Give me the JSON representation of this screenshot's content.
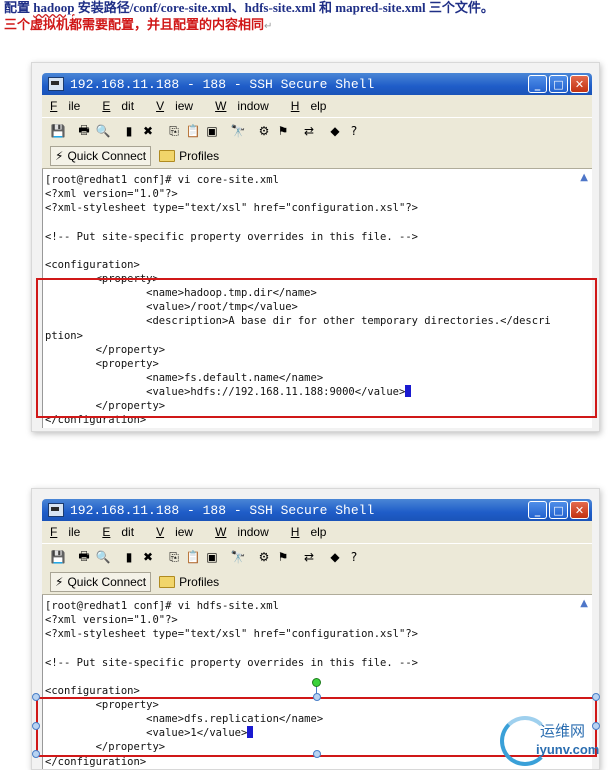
{
  "intro": {
    "line1_prefix": "配置 ",
    "line1_word": "hadoop",
    "line1_rest": " 安装路径/conf/core-site.xml、hdfs-site.xml 和 mapred-site.xml 三个文件。",
    "line2": "三个虚拟机都需要配置，并且配置的内容相同",
    "line2_mark": "↵"
  },
  "window": {
    "title": "192.168.11.188 - 188 - SSH Secure Shell",
    "menu": [
      {
        "first": "F",
        "rest": "ile"
      },
      {
        "first": "E",
        "rest": "dit"
      },
      {
        "first": "V",
        "rest": "iew"
      },
      {
        "first": "W",
        "rest": "indow"
      },
      {
        "first": "H",
        "rest": "elp"
      }
    ],
    "quick_connect": "Quick Connect",
    "profiles": "Profiles"
  },
  "colors": {
    "accent_red": "#d01818",
    "title_blue": "#1f5dc8",
    "cursor_blue": "#1a1ad0"
  },
  "terminal1": {
    "lines": [
      "[root@redhat1 conf]# vi core-site.xml",
      "<?xml version=\"1.0\"?>",
      "<?xml-stylesheet type=\"text/xsl\" href=\"configuration.xsl\"?>",
      "",
      "<!-- Put site-specific property overrides in this file. -->",
      "",
      "<configuration>",
      "        <property>",
      "                <name>hadoop.tmp.dir</name>",
      "                <value>/root/tmp</value>",
      "                <description>A base dir for other temporary directories.</descri",
      "ption>",
      "        </property>",
      "        <property>",
      "                <name>fs.default.name</name>",
      "                <value>hdfs://192.168.11.188:9000</value>",
      "        </property>",
      "</configuration>"
    ]
  },
  "terminal2": {
    "lines": [
      "[root@redhat1 conf]# vi hdfs-site.xml",
      "<?xml version=\"1.0\"?>",
      "<?xml-stylesheet type=\"text/xsl\" href=\"configuration.xsl\"?>",
      "",
      "<!-- Put site-specific property overrides in this file. -->",
      "",
      "<configuration>",
      "        <property>",
      "                <name>dfs.replication</name>",
      "                <value>1</value>",
      "        </property>",
      "</configuration>"
    ]
  },
  "watermark": {
    "cn": "运维网",
    "url": "iyunv.com"
  }
}
